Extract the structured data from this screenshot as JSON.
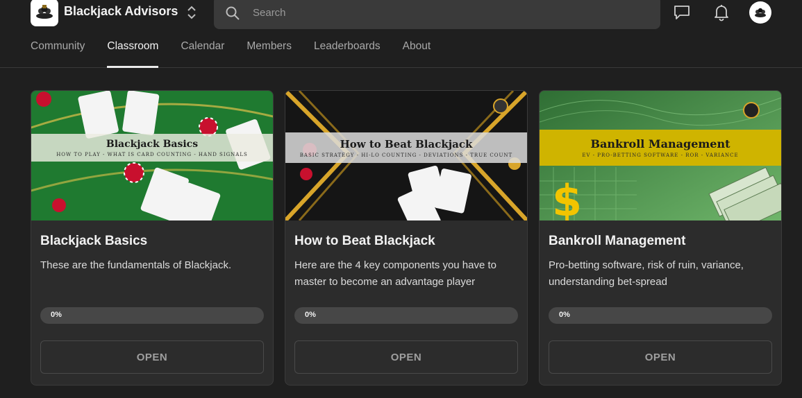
{
  "brand": {
    "name": "Blackjack Advisors"
  },
  "search": {
    "placeholder": "Search"
  },
  "icons": {
    "logo": "blackjack-advisors-logo",
    "switcher": "chevron-up-down-icon",
    "search": "search-icon",
    "chat": "chat-bubble-icon",
    "notifications": "bell-icon",
    "avatar": "user-avatar"
  },
  "tabs": [
    {
      "label": "Community"
    },
    {
      "label": "Classroom",
      "active": true
    },
    {
      "label": "Calendar"
    },
    {
      "label": "Members"
    },
    {
      "label": "Leaderboards"
    },
    {
      "label": "About"
    }
  ],
  "courses": [
    {
      "banner_title": "Blackjack Basics",
      "banner_subtitle": "HOW TO PLAY - WHAT IS CARD COUNTING - HAND SIGNALS",
      "title": "Blackjack Basics",
      "description": "These are the fundamentals of Blackjack.",
      "progress_label": "0%",
      "progress": 0,
      "button": "OPEN"
    },
    {
      "banner_title": "How to Beat Blackjack",
      "banner_subtitle": "BASIC STRATEGY - HI-LO COUNTING - DEVIATIONS - TRUE COUNT",
      "title": "How to Beat Blackjack",
      "description": "Here are the 4 key components you have to master to become an advantage player",
      "progress_label": "0%",
      "progress": 0,
      "button": "OPEN"
    },
    {
      "banner_title": "Bankroll Management",
      "banner_subtitle": "EV - PRO-BETTING SOFTWARE - ROR - VARIANCE",
      "title": "Bankroll Management",
      "description": "Pro-betting software, risk of ruin, variance, understanding bet-spread",
      "progress_label": "0%",
      "progress": 0,
      "button": "OPEN"
    }
  ],
  "colors": {
    "background": "#1f1f1f",
    "card": "#2c2c2c",
    "felt_green": "#1f7a30",
    "gold": "#d6b400"
  }
}
